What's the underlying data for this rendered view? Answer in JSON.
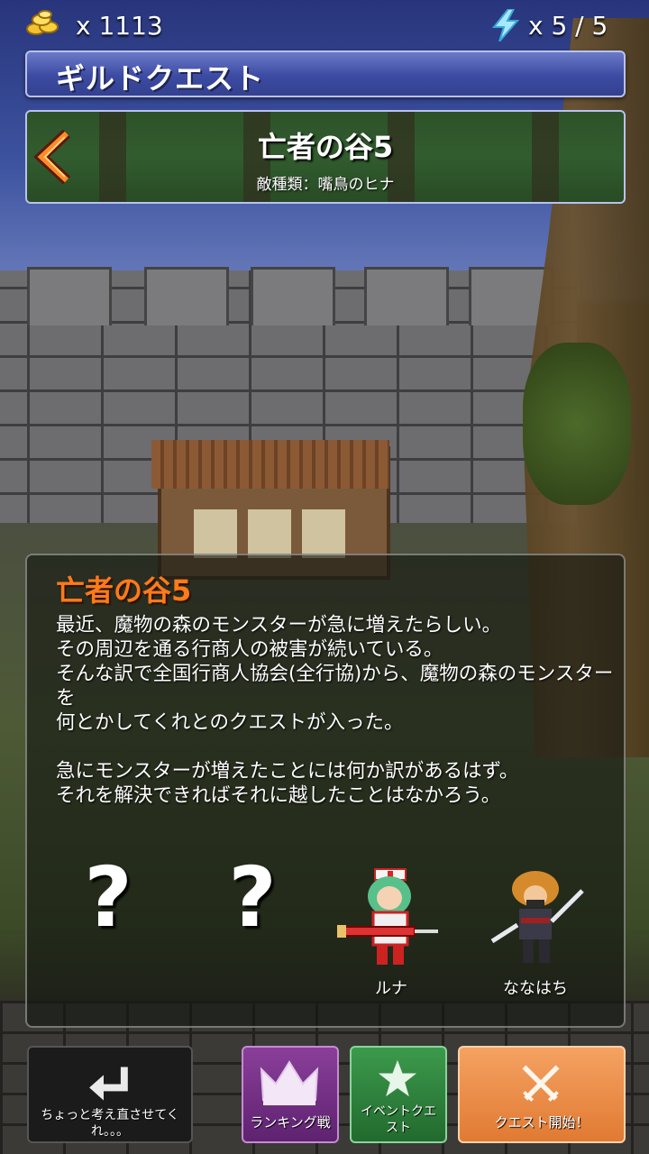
{
  "status": {
    "coin_icon": "gold-coins-icon",
    "coin_count": "x 1113",
    "energy_icon": "lightning-bolt-icon",
    "energy": "x 5 / 5"
  },
  "header": {
    "title": "ギルドクエスト"
  },
  "quest": {
    "back_icon": "back-arrow-icon",
    "name": "亡者の谷5",
    "enemy_type": "敵種類：嘴鳥のヒナ"
  },
  "description": {
    "title": "亡者の谷5",
    "paragraph1": [
      "最近、魔物の森のモンスターが急に増えたらしい。",
      "その周辺を通る行商人の被害が続いている。",
      "そんな訳で全国行商人協会(全行協)から、魔物の森のモンスターを",
      "何とかしてくれとのクエストが入った。"
    ],
    "paragraph2": [
      "急にモンスターが増えたことには何か訳があるはず。",
      "それを解決できればそれに越したことはなかろう。"
    ]
  },
  "party": [
    {
      "type": "unknown",
      "mark": "?"
    },
    {
      "type": "unknown",
      "mark": "?"
    },
    {
      "type": "character",
      "name": "ルナ",
      "sprite": "nurse-girl-sprite"
    },
    {
      "type": "character",
      "name": "ななはち",
      "sprite": "swordsman-sprite"
    }
  ],
  "buttons": {
    "reconsider": {
      "label": "ちょっと考え直させてくれ。。。",
      "icon": "return-arrow-icon"
    },
    "ranking": {
      "label": "ランキング戦",
      "icon": "crown-icon"
    },
    "event": {
      "label": "イベントクエスト",
      "icon": "star-icon"
    },
    "start": {
      "label": "クエスト開始！",
      "icon": "crossed-swords-icon"
    }
  },
  "colors": {
    "title_orange": "#ff7a1a",
    "ranking_purple": "#8a3f9a",
    "event_green": "#3c9a4c",
    "start_orange": "#f5a262"
  }
}
